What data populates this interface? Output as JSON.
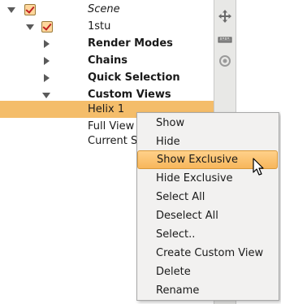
{
  "tree": {
    "nodes": [
      {
        "label": "Scene",
        "expanded": true,
        "checked": true,
        "style": "italic"
      },
      {
        "label": "1stu",
        "expanded": true,
        "checked": true,
        "style": "normal"
      },
      {
        "label": "Render Modes",
        "expanded": false,
        "style": "bold"
      },
      {
        "label": "Chains",
        "expanded": false,
        "style": "bold"
      },
      {
        "label": "Quick Selection",
        "expanded": false,
        "style": "bold"
      },
      {
        "label": "Custom Views",
        "expanded": true,
        "style": "bold"
      },
      {
        "label": "Helix 1",
        "selected": true,
        "style": "normal"
      },
      {
        "label": "Full View",
        "style": "normal"
      },
      {
        "label": "Current S",
        "style": "normal"
      }
    ]
  },
  "toolbar": {
    "icons": [
      "move-icon",
      "ruler-icon",
      "target-icon"
    ]
  },
  "context_menu": {
    "items": [
      {
        "label": "Show"
      },
      {
        "label": "Hide"
      },
      {
        "label": "Show Exclusive",
        "highlighted": true
      },
      {
        "label": "Hide Exclusive"
      },
      {
        "label": "Select All"
      },
      {
        "label": "Deselect All"
      },
      {
        "label": "Select.."
      },
      {
        "label": "Create Custom View"
      },
      {
        "label": "Delete"
      },
      {
        "label": "Rename"
      }
    ]
  },
  "colors": {
    "selection": "#f4bd6a",
    "menu_highlight": "#f7b65b",
    "checkbox_fill": "#ffd79c",
    "check_mark": "#c02020"
  }
}
